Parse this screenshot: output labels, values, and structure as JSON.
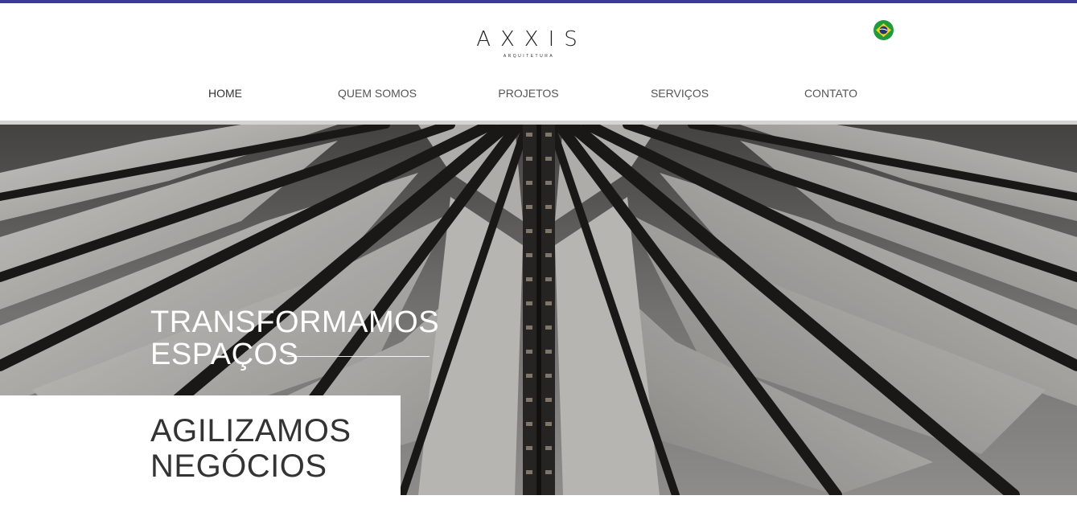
{
  "brand": {
    "name": "AXXIS",
    "tagline": "ARQUITETURA",
    "accent_color": "#3b3a9a"
  },
  "language": {
    "icon": "brazil-flag-icon"
  },
  "nav": {
    "items": [
      {
        "label": "HOME",
        "active": true
      },
      {
        "label": "QUEM SOMOS",
        "active": false
      },
      {
        "label": "PROJETOS",
        "active": false
      },
      {
        "label": "SERVIÇOS",
        "active": false
      },
      {
        "label": "CONTATO",
        "active": false
      }
    ]
  },
  "hero": {
    "headline_line1": "TRANSFORMAMOS",
    "headline_line2": "ESPAÇOS",
    "subheadline_line1": "AGILIZAMOS",
    "subheadline_line2": "NEGÓCIOS"
  }
}
